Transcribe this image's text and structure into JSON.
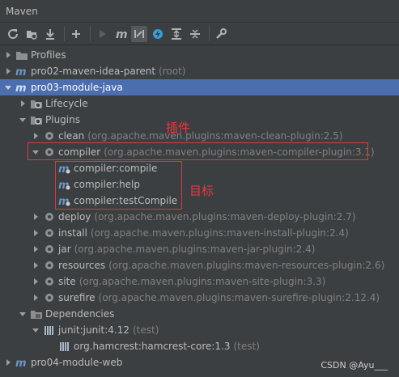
{
  "window": {
    "title": "Maven"
  },
  "toolbar": {
    "buttons": [
      {
        "name": "reload-icon"
      },
      {
        "name": "add-folder-icon"
      },
      {
        "name": "download-icon"
      },
      {
        "name": "plus-icon"
      },
      {
        "name": "run-icon"
      },
      {
        "name": "maven-m-icon"
      },
      {
        "name": "toggle-offline-icon"
      },
      {
        "name": "lightning-icon"
      },
      {
        "name": "expand-all-icon"
      },
      {
        "name": "collapse-all-icon"
      },
      {
        "name": "wrench-icon"
      }
    ]
  },
  "tree": {
    "profiles": "Profiles",
    "parent": {
      "name": "pro02-maven-idea-parent",
      "note": "(root)"
    },
    "module": "pro03-module-java",
    "lifecycle": "Lifecycle",
    "plugins": "Plugins",
    "plugin_items": [
      {
        "name": "clean",
        "coord": "(org.apache.maven.plugins:maven-clean-plugin:2.5)"
      },
      {
        "name": "compiler",
        "coord": "(org.apache.maven.plugins:maven-compiler-plugin:3.1)"
      },
      {
        "name": "deploy",
        "coord": "(org.apache.maven.plugins:maven-deploy-plugin:2.7)"
      },
      {
        "name": "install",
        "coord": "(org.apache.maven.plugins:maven-install-plugin:2.4)"
      },
      {
        "name": "jar",
        "coord": "(org.apache.maven.plugins:maven-jar-plugin:2.4)"
      },
      {
        "name": "resources",
        "coord": "(org.apache.maven.plugins:maven-resources-plugin:2.6)"
      },
      {
        "name": "site",
        "coord": "(org.apache.maven.plugins:maven-site-plugin:3.3)"
      },
      {
        "name": "surefire",
        "coord": "(org.apache.maven.plugins:maven-surefire-plugin:2.12.4)"
      }
    ],
    "goals": [
      "compiler:compile",
      "compiler:help",
      "compiler:testCompile"
    ],
    "dependencies": "Dependencies",
    "dep_junit": {
      "name": "junit:junit:4.12",
      "scope": "(test)"
    },
    "dep_hamcrest": {
      "name": "org.hamcrest:hamcrest-core:1.3",
      "scope": "(test)"
    },
    "module_web": "pro04-module-web"
  },
  "annotations": {
    "plugin": "插件",
    "goal": "目标"
  },
  "watermark": "CSDN @Ayu___",
  "colors": {
    "selection": "#4b6eaf",
    "annotation": "#e8383d",
    "background": "#3c3f41"
  }
}
